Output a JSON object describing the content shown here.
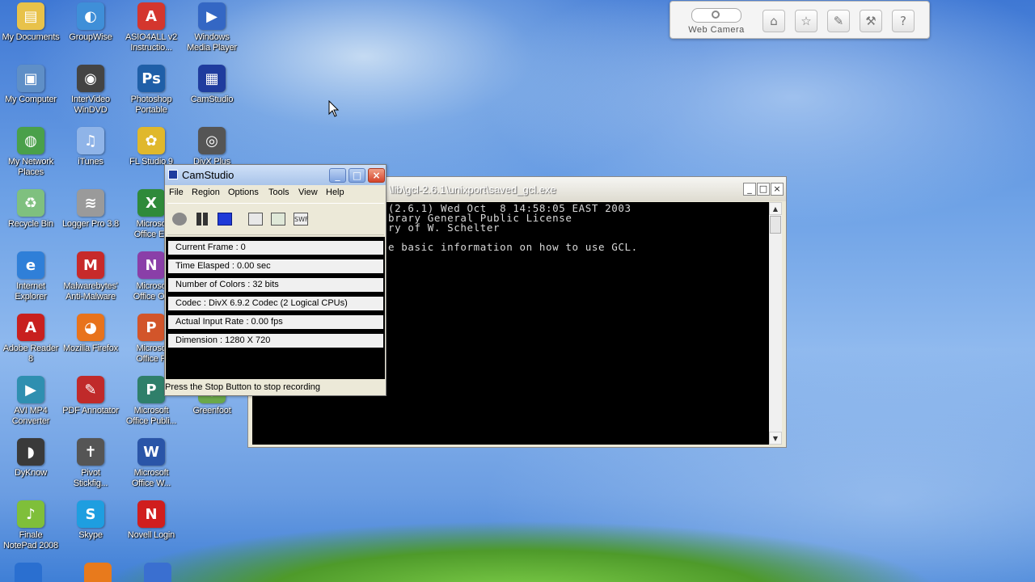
{
  "desktop": {
    "icons": [
      {
        "label": "My Documents",
        "icon": "folder-documents-icon",
        "color": "#e8c24a"
      },
      {
        "label": "GroupWise",
        "icon": "groupwise-icon",
        "color": "#3f8fd8"
      },
      {
        "label": "ASIO4ALL v2\nInstructio...",
        "icon": "pdf-icon",
        "color": "#d4362e"
      },
      {
        "label": "Windows\nMedia Player",
        "icon": "media-player-icon",
        "color": "#3467c4"
      },
      {
        "label": "My Computer",
        "icon": "computer-icon",
        "color": "#5f8fc7"
      },
      {
        "label": "InterVideo\nWinDVD",
        "icon": "windvd-icon",
        "color": "#444444"
      },
      {
        "label": "Photoshop\nPortable",
        "icon": "photoshop-icon",
        "color": "#1f5fa8"
      },
      {
        "label": "CamStudio",
        "icon": "camstudio-icon",
        "color": "#1f3c9e"
      },
      {
        "label": "My Network\nPlaces",
        "icon": "network-icon",
        "color": "#4aa04a"
      },
      {
        "label": "iTunes",
        "icon": "itunes-icon",
        "color": "#8fb4e8"
      },
      {
        "label": "FL Studio 9",
        "icon": "fl-studio-icon",
        "color": "#e0b82c"
      },
      {
        "label": "DivX Plus",
        "icon": "divx-icon",
        "color": "#555555"
      },
      {
        "label": "Recycle Bin",
        "icon": "recycle-bin-icon",
        "color": "#7fc07f"
      },
      {
        "label": "Logger Pro 3.8",
        "icon": "logger-pro-icon",
        "color": "#9a9a9a"
      },
      {
        "label": "Microso\nOffice Ex",
        "icon": "excel-icon",
        "color": "#2f8a3a"
      },
      {
        "label": "Internet\nExplorer",
        "icon": "internet-explorer-icon",
        "color": "#2f7fd8"
      },
      {
        "label": "Malwarebytes'\nAnti-Malware",
        "icon": "malwarebytes-icon",
        "color": "#c72a2a"
      },
      {
        "label": "Microso\nOffice On",
        "icon": "onenote-icon",
        "color": "#8a3fa8"
      },
      {
        "label": "Adobe Reader\n8",
        "icon": "adobe-reader-icon",
        "color": "#c8201e"
      },
      {
        "label": "Mozilla Firefox",
        "icon": "firefox-icon",
        "color": "#e8731c"
      },
      {
        "label": "Microso\nOffice P",
        "icon": "powerpoint-icon",
        "color": "#d2552a"
      },
      {
        "label": "AVI MP4\nConverter",
        "icon": "converter-icon",
        "color": "#2f8fb0"
      },
      {
        "label": "PDF Annotator",
        "icon": "pdf-annotator-icon",
        "color": "#c02a2a"
      },
      {
        "label": "Microsoft\nOffice Publi...",
        "icon": "publisher-icon",
        "color": "#2f7f6a"
      },
      {
        "label": "Greenfoot",
        "icon": "greenfoot-icon",
        "color": "#6aa84a"
      },
      {
        "label": "DyKnow",
        "icon": "dyknow-icon",
        "color": "#3a3a3a"
      },
      {
        "label": "Pivot\nStickfig...",
        "icon": "pivot-icon",
        "color": "#555555"
      },
      {
        "label": "Microsoft\nOffice W...",
        "icon": "word-icon",
        "color": "#2a55a8"
      },
      {
        "label": "Finale\nNotePad 2008",
        "icon": "finale-icon",
        "color": "#7fbf3a"
      },
      {
        "label": "Skype",
        "icon": "skype-icon",
        "color": "#1e9ee0"
      },
      {
        "label": "Novell Login",
        "icon": "novell-icon",
        "color": "#d01e1e"
      }
    ]
  },
  "webcam": {
    "label": "Web Camera",
    "buttons": [
      "home-icon",
      "star-icon",
      "edit-icon",
      "wrench-icon",
      "help-icon"
    ]
  },
  "console": {
    "title": "\\lib\\gcl-2.6.1\\unixport\\saved_gcl.exe",
    "lines": [
      "(2.6.1) Wed Oct  8 14:58:05 EAST 2003",
      "brary General Public License",
      "ry of W. Schelter",
      "",
      "e basic information on how to use GCL."
    ]
  },
  "camstudio": {
    "title": "CamStudio",
    "menu": [
      "File",
      "Region",
      "Options",
      "Tools",
      "View",
      "Help"
    ],
    "stats": [
      "Current Frame : 0",
      "Time Elasped : 0.00 sec",
      "Number of Colors : 32 bits",
      "Codec : DivX 6.9.2 Codec (2 Logical CPUs)",
      "Actual Input Rate : 0.00 fps",
      "Dimension : 1280 X 720"
    ],
    "status": "Press the Stop Button to stop recording",
    "tool_swf": "SWF"
  },
  "glyphs": {
    "minimize": "_",
    "maximize": "□",
    "close": "×",
    "scroll_up": "▲",
    "scroll_down": "▼",
    "help": "?"
  }
}
